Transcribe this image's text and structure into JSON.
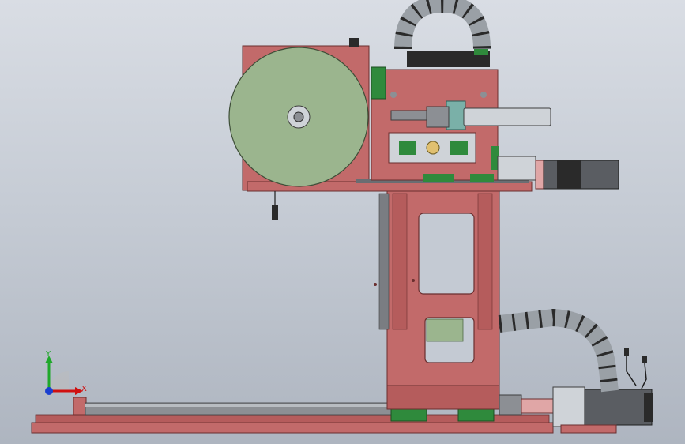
{
  "viewport": {
    "background_top": "#d9dde4",
    "background_bottom": "#aeb5c0"
  },
  "colors": {
    "frame_red": "#c26a6a",
    "frame_edge": "#6a2e2e",
    "disc_green": "#9bb58e",
    "rail_green": "#2f8a3c",
    "cylinder_gray": "#cfd3d8",
    "motor_dark": "#2a2a2a",
    "chain_gray": "#9aa0a6"
  },
  "triad": {
    "y_label": "Y",
    "x_label": "X",
    "y_color": "#1fa82a",
    "x_color": "#d01010",
    "z_color": "#1a3fd0"
  }
}
